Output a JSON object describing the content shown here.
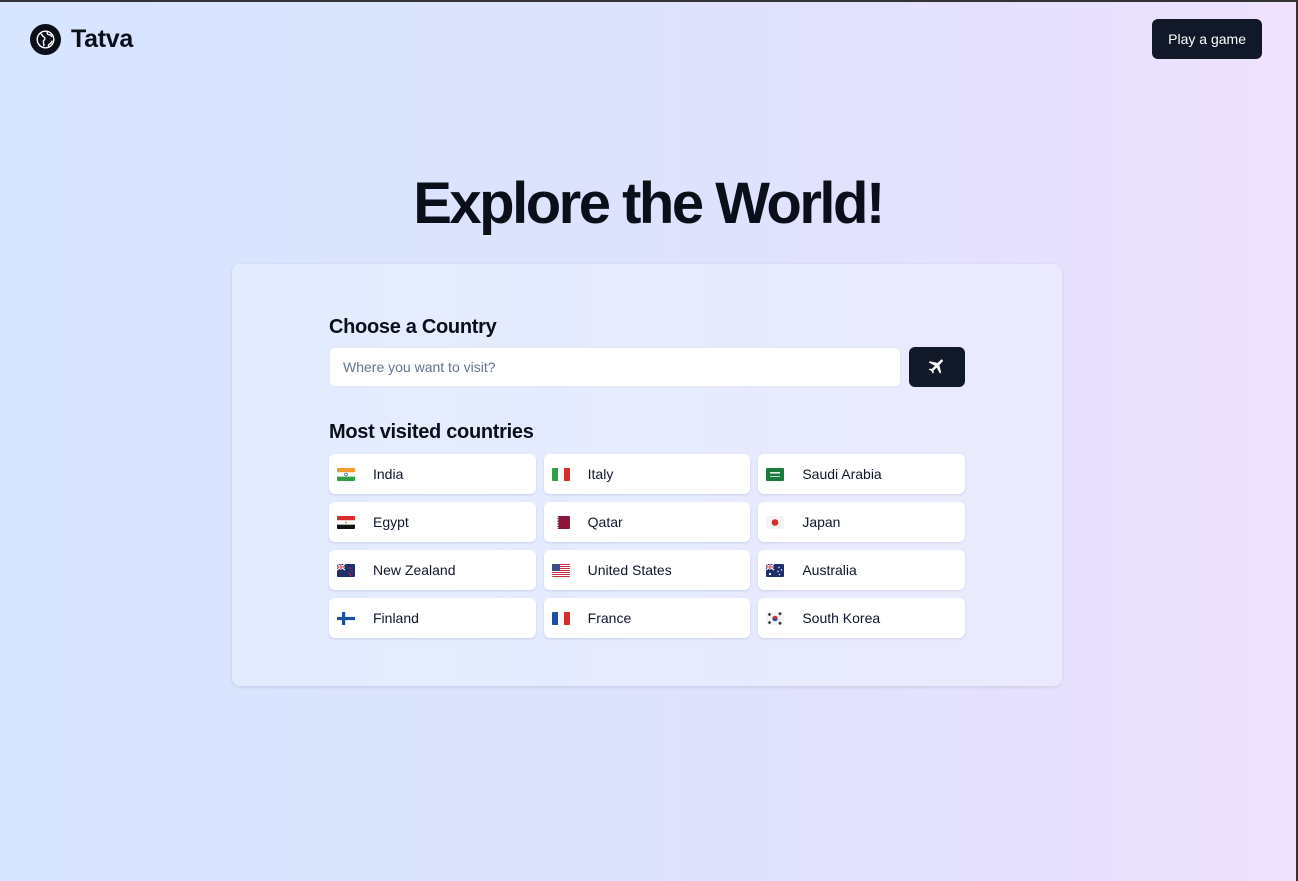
{
  "header": {
    "brand": "Tatva",
    "play_button": "Play a game"
  },
  "hero": {
    "title": "Explore the World!"
  },
  "search": {
    "label": "Choose a Country",
    "placeholder": "Where you want to visit?",
    "value": "",
    "submit_icon": "plane-icon"
  },
  "popular": {
    "label": "Most visited countries",
    "countries": [
      {
        "name": "India",
        "flag": "india-flag-icon"
      },
      {
        "name": "Italy",
        "flag": "italy-flag-icon"
      },
      {
        "name": "Saudi Arabia",
        "flag": "saudi-arabia-flag-icon"
      },
      {
        "name": "Egypt",
        "flag": "egypt-flag-icon"
      },
      {
        "name": "Qatar",
        "flag": "qatar-flag-icon"
      },
      {
        "name": "Japan",
        "flag": "japan-flag-icon"
      },
      {
        "name": "New Zealand",
        "flag": "new-zealand-flag-icon"
      },
      {
        "name": "United States",
        "flag": "united-states-flag-icon"
      },
      {
        "name": "Australia",
        "flag": "australia-flag-icon"
      },
      {
        "name": "Finland",
        "flag": "finland-flag-icon"
      },
      {
        "name": "France",
        "flag": "france-flag-icon"
      },
      {
        "name": "South Korea",
        "flag": "south-korea-flag-icon"
      }
    ]
  },
  "colors": {
    "primary": "#111827",
    "text": "#0b0f1a",
    "muted": "#64748b"
  }
}
